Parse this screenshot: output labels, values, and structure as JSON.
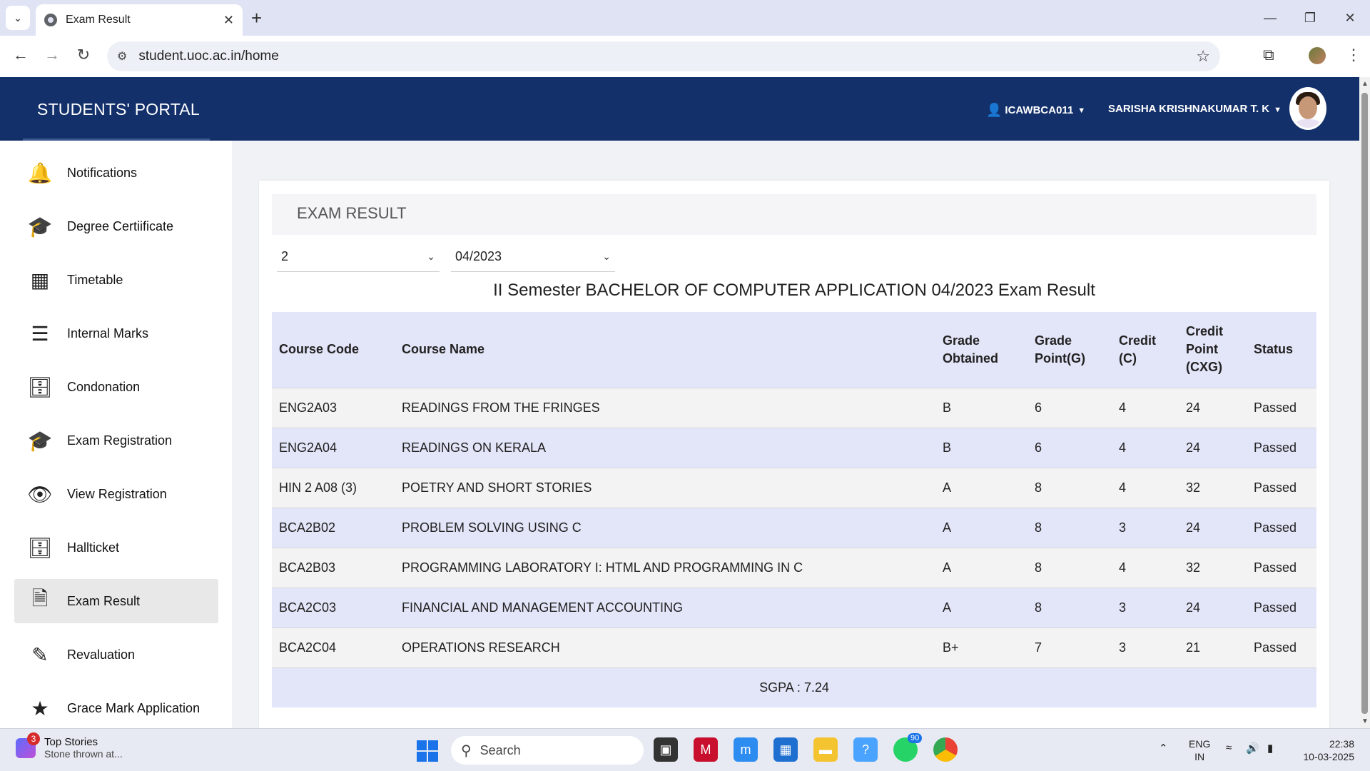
{
  "browser": {
    "tab_title": "Exam Result",
    "url": "student.uoc.ac.in/home"
  },
  "portal": {
    "brand": "STUDENTS' PORTAL",
    "user_code": "ICAWBCA011",
    "user_name": "SARISHA KRISHNAKUMAR T. K"
  },
  "sidebar": {
    "items": [
      {
        "label": "Notifications",
        "icon": "bell-icon"
      },
      {
        "label": "Degree Certiificate",
        "icon": "graduation-cap-icon"
      },
      {
        "label": "Timetable",
        "icon": "table-icon"
      },
      {
        "label": "Internal Marks",
        "icon": "list-icon"
      },
      {
        "label": "Condonation",
        "icon": "id-card-icon"
      },
      {
        "label": "Exam Registration",
        "icon": "graduation-cap-icon"
      },
      {
        "label": "View Registration",
        "icon": "eye-icon"
      },
      {
        "label": "Hallticket",
        "icon": "id-card-icon"
      },
      {
        "label": "Exam Result",
        "icon": "document-icon",
        "active": true
      },
      {
        "label": "Revaluation",
        "icon": "edit-icon"
      },
      {
        "label": "Grace Mark Application",
        "icon": "star-icon"
      }
    ]
  },
  "exam_result": {
    "title": "EXAM RESULT",
    "semester_select": "2",
    "session_select": "04/2023",
    "heading": "II Semester BACHELOR OF COMPUTER APPLICATION 04/2023 Exam Result",
    "columns": [
      "Course Code",
      "Course Name",
      "Grade Obtained",
      "Grade Point(G)",
      "Credit (C)",
      "Credit Point (CXG)",
      "Status"
    ],
    "rows": [
      [
        "ENG2A03",
        "READINGS FROM THE FRINGES",
        "B",
        "6",
        "4",
        "24",
        "Passed"
      ],
      [
        "ENG2A04",
        "READINGS ON KERALA",
        "B",
        "6",
        "4",
        "24",
        "Passed"
      ],
      [
        "HIN 2 A08 (3)",
        "POETRY AND SHORT STORIES",
        "A",
        "8",
        "4",
        "32",
        "Passed"
      ],
      [
        "BCA2B02",
        "PROBLEM SOLVING USING C",
        "A",
        "8",
        "3",
        "24",
        "Passed"
      ],
      [
        "BCA2B03",
        "PROGRAMMING LABORATORY I: HTML AND PROGRAMMING IN C",
        "A",
        "8",
        "4",
        "32",
        "Passed"
      ],
      [
        "BCA2C03",
        "FINANCIAL AND MANAGEMENT ACCOUNTING",
        "A",
        "8",
        "3",
        "24",
        "Passed"
      ],
      [
        "BCA2C04",
        "OPERATIONS RESEARCH",
        "B+",
        "7",
        "3",
        "21",
        "Passed"
      ]
    ],
    "sgpa": "SGPA : 7.24"
  },
  "taskbar": {
    "news_title": "Top Stories",
    "news_subtitle": "Stone thrown at...",
    "news_badge": "3",
    "search_placeholder": "Search",
    "whatsapp_badge": "90",
    "lang_line1": "ENG",
    "lang_line2": "IN",
    "time": "22:38",
    "date": "10-03-2025"
  },
  "colors": {
    "header_bg": "#13306a",
    "table_header_bg": "#e3e5f8",
    "row_alt_bg": "#f3f3f3"
  }
}
